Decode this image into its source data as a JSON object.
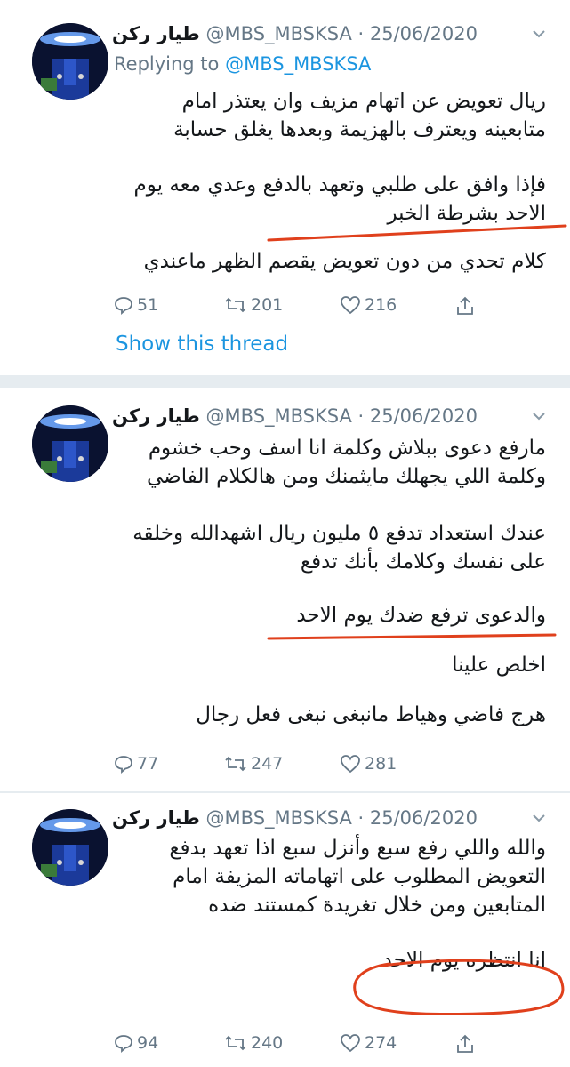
{
  "tweets": [
    {
      "name": "طيار ركن",
      "meta": "@MBS_MBSKSA · 25/06/2020",
      "replying_prefix": "Replying to ",
      "replying_handle": "@MBS_MBSKSA",
      "paragraphs": [
        "ريال تعويض عن اتهام مزيف وان يعتذر امام متابعينه ويعترف بالهزيمة وبعدها يغلق حسابة",
        "فإذا وافق على طلبي وتعهد بالدفع وعدي معه يوم الاحد بشرطة الخبر",
        "كلام تحدي من دون تعويض يقصم الظهر ماعندي"
      ],
      "stats": {
        "replies": "51",
        "retweets": "201",
        "likes": "216"
      },
      "show_thread": "Show this thread"
    },
    {
      "name": "طيار ركن",
      "meta": "@MBS_MBSKSA · 25/06/2020",
      "paragraphs": [
        "مارفع دعوى ببلاش وكلمة انا اسف وحب خشوم وكلمة اللي يجهلك مايثمنك ومن هالكلام الفاضي",
        "عندك استعداد تدفع ٥ مليون ريال اشهدالله وخلقه على نفسك وكلامك بأنك تدفع",
        "والدعوى ترفع ضدك يوم الاحد",
        "اخلص علينا",
        "هرج فاضي وهياط مانبغى نبغى فعل رجال"
      ],
      "stats": {
        "replies": "77",
        "retweets": "247",
        "likes": "281"
      }
    },
    {
      "name": "طيار ركن",
      "meta": "@MBS_MBSKSA · 25/06/2020",
      "paragraphs": [
        "والله واللي رفع سبع وأنزل سبع اذا تعهد بدفع التعويض المطلوب على اتهاماته المزيفة امام المتابعين ومن خلال تغريدة كمستند ضده",
        "انا انتظره يوم الاحد"
      ],
      "stats": {
        "replies": "94",
        "retweets": "240",
        "likes": "274"
      }
    }
  ],
  "icons": [
    "avatar",
    "chevron-down-icon",
    "reply-icon",
    "retweet-icon",
    "like-icon",
    "share-icon"
  ],
  "colors": {
    "accent": "#1b95e0",
    "muted": "#657786",
    "divider": "#e6ecf0",
    "markup": "#e0401c"
  }
}
